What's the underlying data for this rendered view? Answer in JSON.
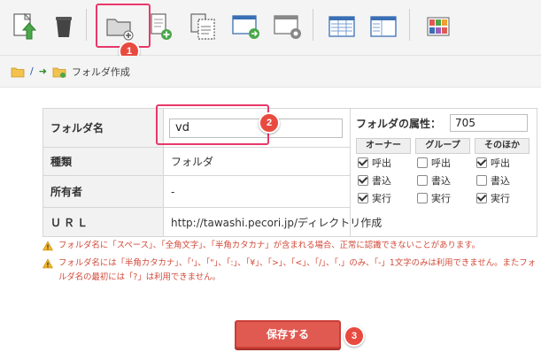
{
  "toolbar": {
    "icons": [
      "upload-icon",
      "trash-icon",
      "new-folder-icon",
      "new-file-icon",
      "copy-icon",
      "move-icon",
      "permission-icon",
      "list-view-icon",
      "panel-view-icon",
      "apps-icon"
    ]
  },
  "annotations": [
    "1",
    "2",
    "3"
  ],
  "breadcrumb": {
    "root": "/",
    "current": "フォルダ作成"
  },
  "form": {
    "folder_name_label": "フォルダ名",
    "folder_name_value": "vd",
    "type_label": "種類",
    "type_value": "フォルダ",
    "owner_label": "所有者",
    "owner_value": "-",
    "url_label": "ＵＲＬ",
    "url_value": "http://tawashi.pecori.jp/ディレクトリ作成",
    "attr_label": "フォルダの属性：",
    "attr_value": "705",
    "perm_heads": [
      "オーナー",
      "グループ",
      "そのほか"
    ],
    "perm_labels": [
      "呼出",
      "書込",
      "実行"
    ],
    "perms": {
      "owner": [
        true,
        true,
        true
      ],
      "group": [
        false,
        false,
        false
      ],
      "other": [
        true,
        false,
        true
      ]
    }
  },
  "notes": [
    "フォルダ名に「スペース」、「全角文字」、「半角カタカナ」が含まれる場合、正常に認識できないことがあります。",
    "フォルダ名には「半角カタカナ」、「'」、「\"」、「:」、「¥」、「>」、「<」、「/」、「.」のみ、「-」1文字のみは利用できません。またフォルダ名の最初には「?」は利用できません。"
  ],
  "save_label": "保存する",
  "colors": {
    "accent": "#e05a52",
    "highlight": "#e8386a",
    "note": "#d24a3a"
  }
}
